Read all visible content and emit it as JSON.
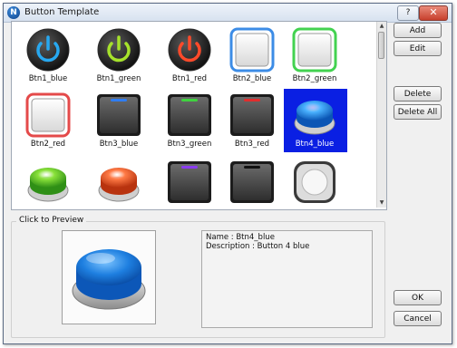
{
  "window": {
    "title": "Button Template",
    "help_label": "?",
    "close_label": "✕"
  },
  "gallery": {
    "items": [
      {
        "label": "Btn1_blue",
        "icon": "power-icon-blue"
      },
      {
        "label": "Btn1_green",
        "icon": "power-icon-green"
      },
      {
        "label": "Btn1_red",
        "icon": "power-icon-red"
      },
      {
        "label": "Btn2_blue",
        "icon": "square-button-blue-frame"
      },
      {
        "label": "Btn2_green",
        "icon": "square-button-green-frame"
      },
      {
        "label": "Btn2_red",
        "icon": "square-button-red-frame"
      },
      {
        "label": "Btn3_blue",
        "icon": "dark-button-blue-led"
      },
      {
        "label": "Btn3_green",
        "icon": "dark-button-green-led"
      },
      {
        "label": "Btn3_red",
        "icon": "dark-button-red-led"
      },
      {
        "label": "Btn4_blue",
        "icon": "round-push-button-blue",
        "selected": true
      },
      {
        "label": "",
        "icon": "round-push-button-green"
      },
      {
        "label": "",
        "icon": "round-push-button-red"
      },
      {
        "label": "",
        "icon": "dark-button-purple-led"
      },
      {
        "label": "",
        "icon": "dark-button-black-led"
      },
      {
        "label": "",
        "icon": "round-white-knob"
      }
    ],
    "scroll_up": "▲",
    "scroll_down": "▼"
  },
  "buttons": {
    "add": "Add",
    "edit": "Edit",
    "delete": "Delete",
    "delete_all": "Delete All",
    "ok": "OK",
    "cancel": "Cancel"
  },
  "preview": {
    "group_label": "Click to Preview",
    "name_line": "Name : Btn4_blue",
    "description_line": "Description  : Button 4 blue"
  }
}
